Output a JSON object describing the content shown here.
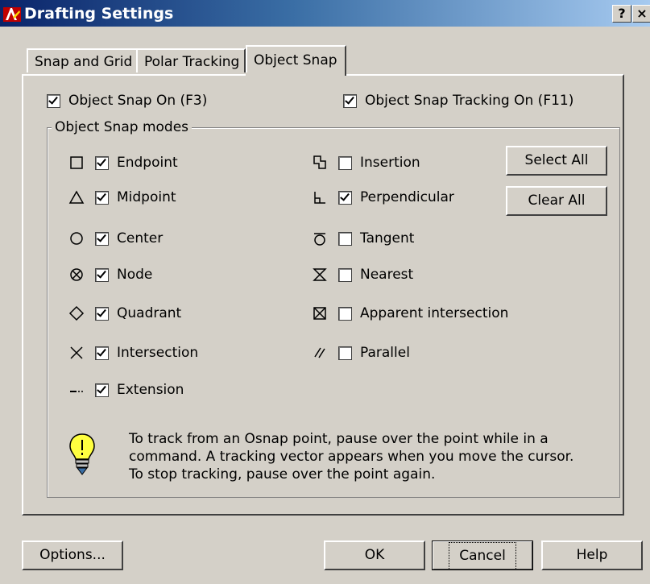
{
  "window": {
    "title": "Drafting Settings",
    "help_button": "?",
    "close_button": "×"
  },
  "tabs": [
    {
      "label": "Snap and Grid",
      "active": false
    },
    {
      "label": "Polar Tracking",
      "active": false
    },
    {
      "label": "Object Snap",
      "active": true
    }
  ],
  "toggles": {
    "osnap_on": {
      "label": "Object Snap On (F3)",
      "checked": true
    },
    "tracking_on": {
      "label": "Object Snap Tracking On (F11)",
      "checked": true
    }
  },
  "modes_group": {
    "title": "Object Snap modes",
    "left": [
      {
        "label": "Endpoint",
        "checked": true,
        "icon": "endpoint-icon"
      },
      {
        "label": "Midpoint",
        "checked": true,
        "icon": "midpoint-icon"
      },
      {
        "label": "Center",
        "checked": true,
        "icon": "center-icon"
      },
      {
        "label": "Node",
        "checked": true,
        "icon": "node-icon"
      },
      {
        "label": "Quadrant",
        "checked": true,
        "icon": "quadrant-icon"
      },
      {
        "label": "Intersection",
        "checked": true,
        "icon": "intersection-icon"
      },
      {
        "label": "Extension",
        "checked": true,
        "icon": "extension-icon"
      }
    ],
    "right": [
      {
        "label": "Insertion",
        "checked": false,
        "icon": "insertion-icon"
      },
      {
        "label": "Perpendicular",
        "checked": true,
        "icon": "perpendicular-icon"
      },
      {
        "label": "Tangent",
        "checked": false,
        "icon": "tangent-icon"
      },
      {
        "label": "Nearest",
        "checked": false,
        "icon": "nearest-icon"
      },
      {
        "label": "Apparent intersection",
        "checked": false,
        "icon": "apparent-intersection-icon"
      },
      {
        "label": "Parallel",
        "checked": false,
        "icon": "parallel-icon"
      }
    ],
    "select_all": "Select All",
    "clear_all": "Clear All"
  },
  "info": {
    "icon": "lightbulb-icon",
    "lines": [
      "To track from an Osnap point, pause over the point while in a",
      "command.  A tracking vector appears when you move the cursor.",
      "To stop tracking, pause over the point again."
    ]
  },
  "footer": {
    "options": "Options...",
    "ok": "OK",
    "cancel": "Cancel",
    "help": "Help"
  }
}
